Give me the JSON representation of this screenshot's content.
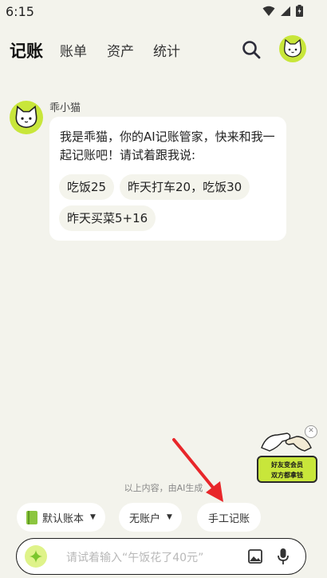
{
  "status_bar": {
    "time": "6:15"
  },
  "nav": {
    "tabs": [
      {
        "label": "记账"
      },
      {
        "label": "账单"
      },
      {
        "label": "资产"
      },
      {
        "label": "统计"
      }
    ]
  },
  "chat": {
    "bot_name": "乖小猫",
    "message": "我是乖猫，你的AI记账管家，快来和我一起记账吧！请试着跟我说:",
    "suggestions": [
      "吃饭25",
      "昨天打车20，吃饭30",
      "昨天买菜5+16"
    ]
  },
  "ai_note": "以上内容，由AI生成",
  "promo": {
    "line1": "好友变会员",
    "line2": "双方都拿钱"
  },
  "actions": {
    "book": "默认账本",
    "account": "无账户",
    "manual": "手工记账"
  },
  "input": {
    "placeholder": "请试着输入“午饭花了40元”"
  },
  "colors": {
    "accent": "#c8e63a",
    "arrow": "#e8262a",
    "background": "#f3f3ec"
  }
}
